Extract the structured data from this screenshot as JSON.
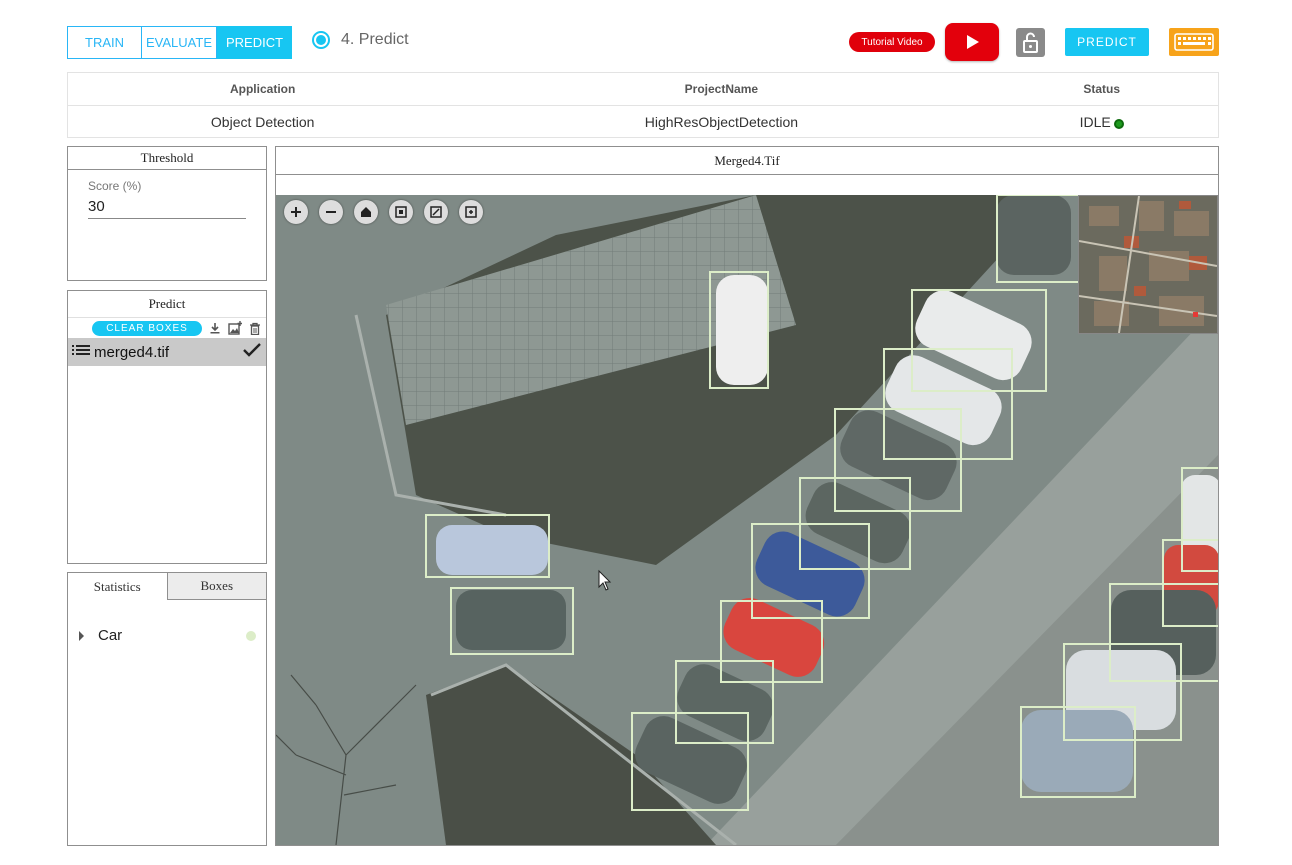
{
  "header": {
    "modes": {
      "train": "TRAIN",
      "evaluate": "EVALUATE",
      "predict": "PREDICT"
    },
    "step_label": "4. Predict",
    "tutorial_label": "Tutorial Video",
    "predict_button": "PREDICT",
    "icons": [
      "youtube-play-icon",
      "lock-icon",
      "keyboard-icon"
    ]
  },
  "info": {
    "headers": {
      "application": "Application",
      "project": "ProjectName",
      "status": "Status"
    },
    "application": "Object Detection",
    "project": "HighResObjectDetection",
    "status": "IDLE",
    "status_color": "#1e9b1e"
  },
  "threshold": {
    "title": "Threshold",
    "score_label": "Score (%)",
    "score_value": "30"
  },
  "predict_panel": {
    "title": "Predict",
    "clear_label": "CLEAR BOXES",
    "file": "merged4.tif"
  },
  "stats": {
    "tabs": {
      "statistics": "Statistics",
      "boxes": "Boxes"
    },
    "classes": [
      {
        "label": "Car",
        "color": "#dcedc8"
      }
    ]
  },
  "viewer": {
    "title": "Merged4.Tif",
    "box_color": "#dcedc8",
    "zoom_controls": [
      "zoom-in-icon",
      "zoom-out-icon",
      "home-icon",
      "fit-icon",
      "fullscreen-icon",
      "rotate-icon"
    ]
  },
  "colors": {
    "accent": "#17c6f2",
    "youtube": "#e3000c",
    "keyboard": "#f7a31a"
  }
}
